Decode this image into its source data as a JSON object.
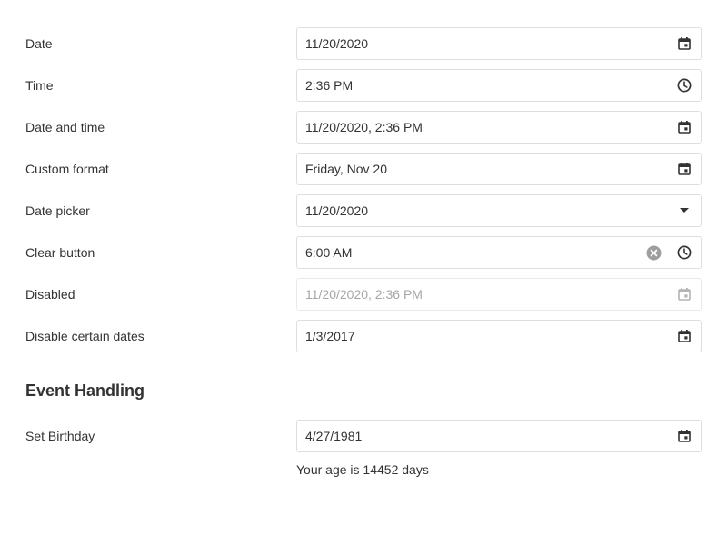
{
  "rows": {
    "date": {
      "label": "Date",
      "value": "11/20/2020"
    },
    "time": {
      "label": "Time",
      "value": "2:36 PM"
    },
    "datetime": {
      "label": "Date and time",
      "value": "11/20/2020, 2:36 PM"
    },
    "custom_format": {
      "label": "Custom format",
      "value": "Friday, Nov 20"
    },
    "date_picker": {
      "label": "Date picker",
      "value": "11/20/2020"
    },
    "clear_button": {
      "label": "Clear button",
      "value": "6:00 AM"
    },
    "disabled": {
      "label": "Disabled",
      "value": "11/20/2020, 2:36 PM"
    },
    "disable_certain_dates": {
      "label": "Disable certain dates",
      "value": "1/3/2017"
    }
  },
  "event_handling": {
    "heading": "Event Handling",
    "birthday": {
      "label": "Set Birthday",
      "value": "4/27/1981"
    },
    "age_text": "Your age is 14452 days"
  },
  "icons": {
    "date": "calendar-icon",
    "time": "clock-icon",
    "datetime": "calendar-icon",
    "custom_format": "calendar-icon",
    "date_picker": "caret-down-icon",
    "clear_button_clear": "clear-circle-icon",
    "clear_button": "clock-icon",
    "disabled": "calendar-icon",
    "disable_certain_dates": "calendar-icon",
    "birthday": "calendar-icon"
  },
  "colors": {
    "text": "#333333",
    "icon": "#333333",
    "icon_disabled": "#b3b3b3",
    "clear_icon": "#9e9e9e",
    "border": "#dedede",
    "disabled_text": "#a6a6a6"
  }
}
